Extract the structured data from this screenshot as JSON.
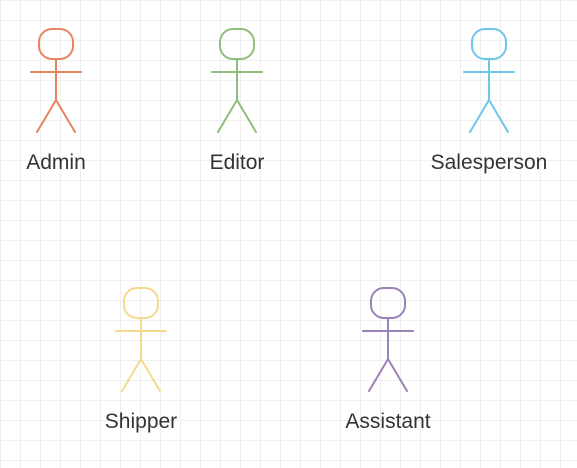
{
  "diagram": {
    "actors": [
      {
        "id": "admin",
        "label": "Admin",
        "color": "#e8855f"
      },
      {
        "id": "editor",
        "label": "Editor",
        "color": "#8fbf7f"
      },
      {
        "id": "salesperson",
        "label": "Salesperson",
        "color": "#6ec6e8"
      },
      {
        "id": "shipper",
        "label": "Shipper",
        "color": "#f5d98f"
      },
      {
        "id": "assistant",
        "label": "Assistant",
        "color": "#9b82b8"
      }
    ]
  }
}
